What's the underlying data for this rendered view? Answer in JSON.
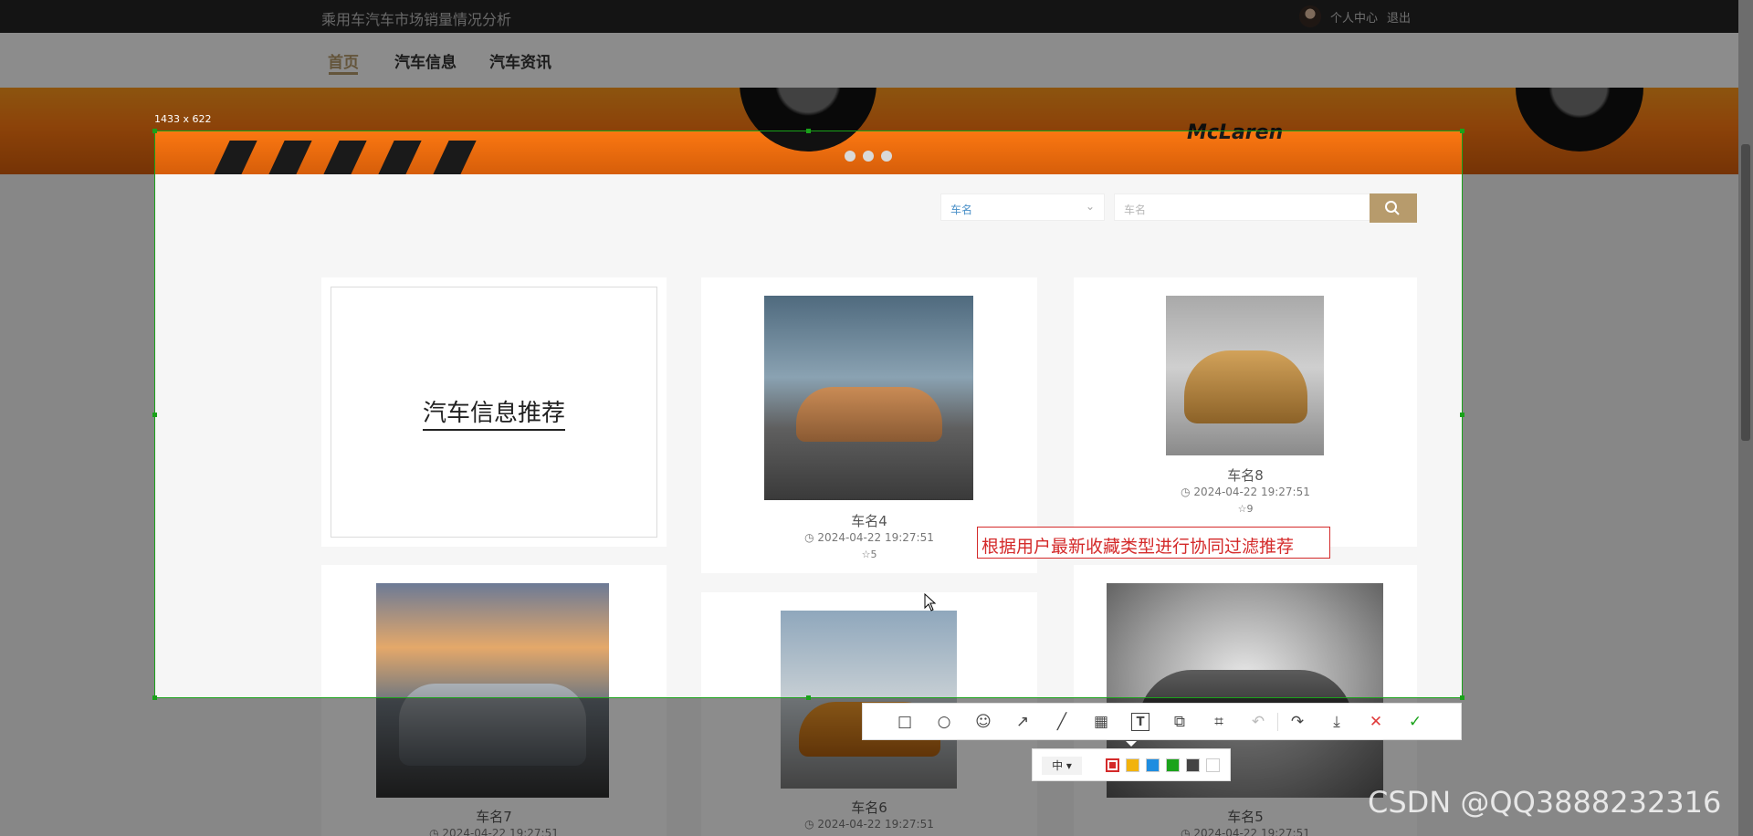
{
  "header": {
    "site_title": "乘用车汽车市场销量情况分析",
    "user_center": "个人中心",
    "logout": "退出"
  },
  "nav": {
    "items": [
      "首页",
      "汽车信息",
      "汽车资讯"
    ],
    "active_index": 0
  },
  "banner": {
    "brand_text": "McLaren",
    "dot_count": 3
  },
  "search": {
    "select_value": "车名",
    "input_placeholder": "车名",
    "search_icon": "search-icon"
  },
  "promo": {
    "title": "汽车信息推荐"
  },
  "cards": [
    {
      "name": "车名4",
      "time": "2024-04-22 19:27:51",
      "likes": "5"
    },
    {
      "name": "车名8",
      "time": "2024-04-22 19:27:51",
      "likes": "9"
    },
    {
      "name": "车名7",
      "time": "2024-04-22 19:27:51",
      "likes": ""
    },
    {
      "name": "车名6",
      "time": "2024-04-22 19:27:51",
      "likes": ""
    },
    {
      "name": "车名5",
      "time": "2024-04-22 19:27:51",
      "likes": ""
    }
  ],
  "screenshot_tool": {
    "size_label": "1433 x 622",
    "annotation_text": "根据用户最新收藏类型进行协同过滤推荐",
    "tools": [
      "rectangle-icon",
      "ellipse-icon",
      "emoji-icon",
      "arrow-icon",
      "line-icon",
      "mosaic-icon",
      "text-icon",
      "copy-icon",
      "ocr-icon",
      "undo-icon",
      "share-icon",
      "save-icon",
      "cancel-icon",
      "confirm-icon"
    ],
    "font_size": "中",
    "colors": [
      "#d42a2a",
      "#f2b30c",
      "#1e8de0",
      "#1ba31b",
      "#444444",
      "#ffffff"
    ]
  },
  "watermark": "CSDN @QQ3888232316"
}
